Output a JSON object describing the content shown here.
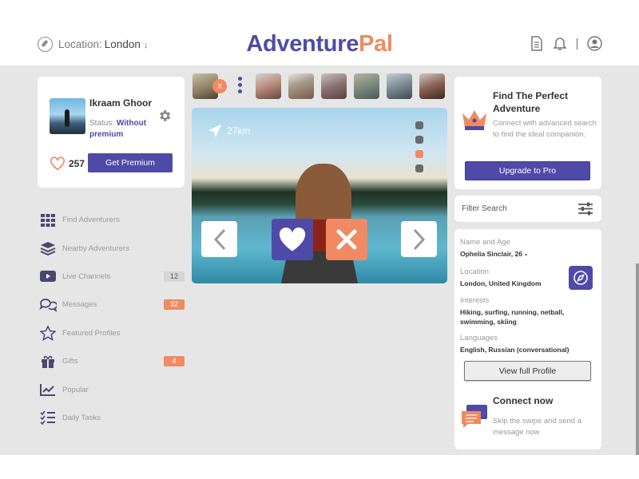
{
  "header": {
    "location_label": "Location:",
    "location_value": "London",
    "location_arrow": "↓",
    "logo_part1": "Adventure",
    "logo_part2": "Pal",
    "icons": [
      "document-icon",
      "bell-icon",
      "user-icon"
    ]
  },
  "profile": {
    "name": "Ikraam Ghoor",
    "status_label": "Status:",
    "status_value": "Without premium",
    "likes": "257",
    "premium_button": "Get Premium"
  },
  "menu": {
    "items": [
      {
        "label": "Find Adventurers",
        "icon": "grid-icon"
      },
      {
        "label": "Nearby Adventurers",
        "icon": "layers-icon"
      },
      {
        "label": "Live Channels",
        "icon": "play-icon",
        "badge": "12"
      },
      {
        "label": "Messages",
        "icon": "chat-icon",
        "badge": "32"
      },
      {
        "label": "Featured Profiles",
        "icon": "star-icon"
      },
      {
        "label": "Gifts",
        "icon": "gift-icon",
        "badge": "4"
      },
      {
        "label": "Popular",
        "icon": "chart-icon"
      },
      {
        "label": "Daily Tasks",
        "icon": "checklist-icon"
      }
    ]
  },
  "stories": {
    "close_badge": "X"
  },
  "photo": {
    "distance": "27km"
  },
  "find": {
    "title": "Find The Perfect Adventure",
    "text": "Connect with advanced search to find the ideal companion.",
    "button": "Upgrade to Pro"
  },
  "filter": {
    "label": "Filter Search"
  },
  "details": {
    "name_label": "Name and Age",
    "name_value": "Ophelia Sinclair, 26",
    "location_label": "Location",
    "location_value": "London, United Kingdom",
    "interests_label": "Interests",
    "interests_value": "Hiking, surfing, running, netball, swimming, skiing",
    "languages_label": "Languages",
    "languages_value": "English, Russian (conversational)",
    "view_button": "View full Profile",
    "connect_title": "Connect now",
    "connect_text": "Skip the swipe and send a message now"
  },
  "colors": {
    "brand_purple": "#4f4aa8",
    "brand_orange": "#ef8a62",
    "background_grey": "#e6e6e6"
  }
}
